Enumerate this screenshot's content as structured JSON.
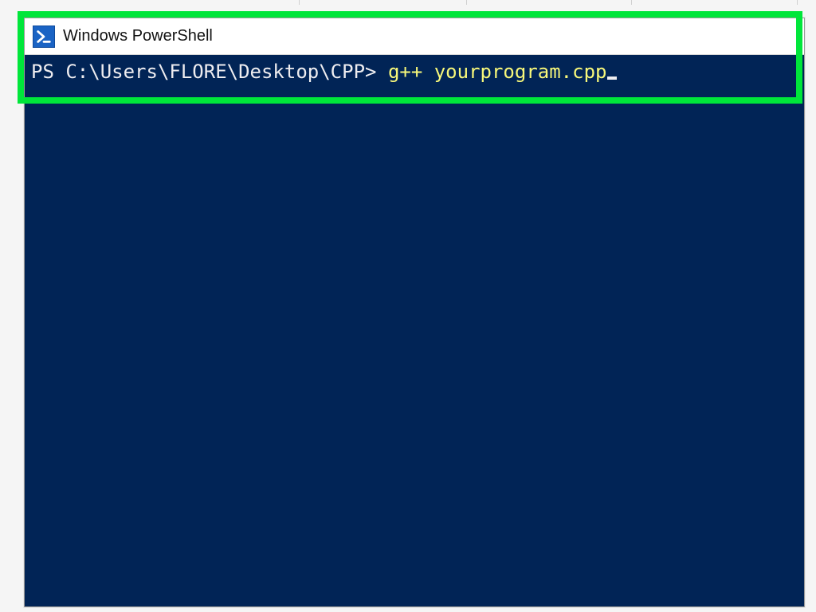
{
  "window": {
    "title": "Windows PowerShell"
  },
  "terminal": {
    "prompt": "PS C:\\Users\\FLORE\\Desktop\\CPP> ",
    "command": "g++ yourprogram.cpp"
  },
  "colors": {
    "highlight_border": "#00e63a",
    "terminal_bg": "#012456",
    "terminal_fg": "#eeedf0",
    "command_fg": "#f8f87a",
    "ps_icon_bg": "#1a63c4"
  }
}
